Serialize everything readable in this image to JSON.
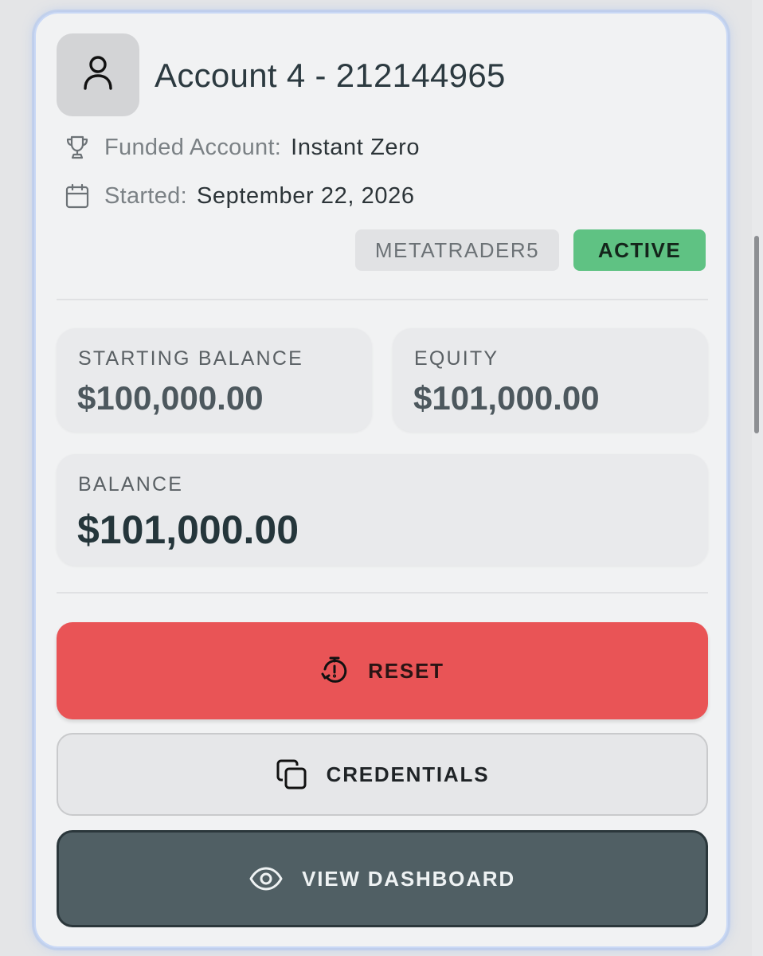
{
  "account": {
    "title": "Account 4 - 212144965",
    "funded_label": "Funded Account:",
    "funded_value": "Instant Zero",
    "started_label": "Started:",
    "started_value": "September 22, 2026"
  },
  "badges": {
    "platform": "METATRADER5",
    "status": "ACTIVE",
    "status_color": "#5fc283"
  },
  "stats": {
    "starting_balance_label": "STARTING BALANCE",
    "starting_balance_value": "$100,000.00",
    "equity_label": "EQUITY",
    "equity_value": "$101,000.00",
    "balance_label": "BALANCE",
    "balance_value": "$101,000.00"
  },
  "actions": {
    "reset_label": "RESET",
    "reset_color": "#e95456",
    "credentials_label": "CREDENTIALS",
    "dashboard_label": "VIEW DASHBOARD",
    "dashboard_color": "#505f64"
  },
  "icons": [
    "user-icon",
    "trophy-icon",
    "calendar-icon",
    "timer-reset-icon",
    "copy-icon",
    "eye-icon"
  ]
}
